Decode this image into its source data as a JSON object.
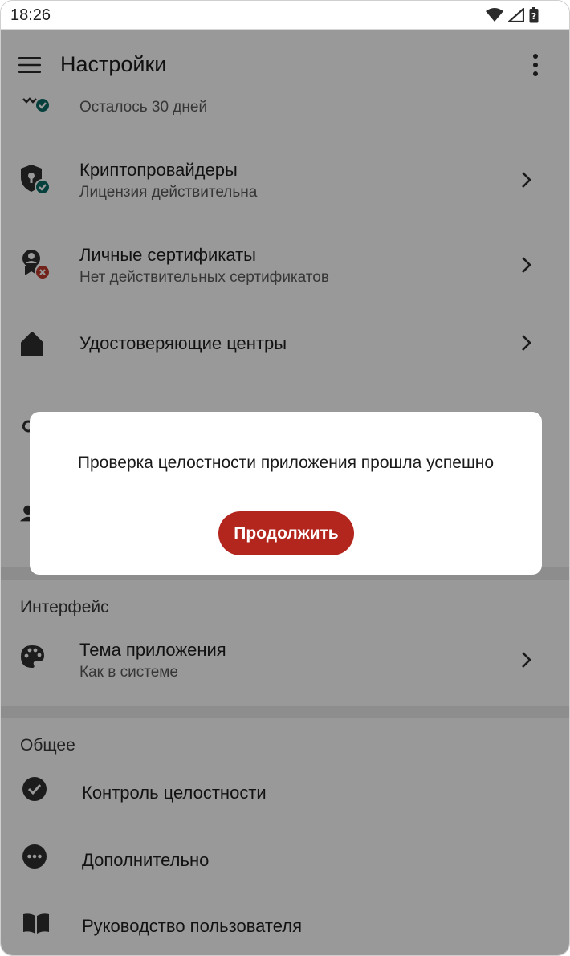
{
  "status_bar": {
    "time": "18:26"
  },
  "header": {
    "title": "Настройки"
  },
  "rows": {
    "trial": {
      "subtitle": "Осталось 30 дней"
    },
    "crypto": {
      "title": "Криптопровайдеры",
      "subtitle": "Лицензия действительна"
    },
    "personal_certs": {
      "title": "Личные сертификаты",
      "subtitle": "Нет действительных сертификатов"
    },
    "cas": {
      "title": "Удостоверяющие центры"
    },
    "theme": {
      "title": "Тема приложения",
      "subtitle": "Как в системе"
    },
    "integrity": {
      "title": "Контроль целостности"
    },
    "advanced": {
      "title": "Дополнительно"
    },
    "manual": {
      "title": "Руководство пользователя"
    }
  },
  "sections": {
    "interface": "Интерфейс",
    "general": "Общее"
  },
  "dialog": {
    "message": "Проверка целостности приложения прошла успешно",
    "button": "Продолжить"
  },
  "colors": {
    "accent": "#b3261e",
    "ok_badge": "#0b6b67",
    "error_badge": "#c0392b",
    "icon": "#2f2f2f"
  },
  "icons": {
    "status": [
      "wifi-icon",
      "cellular-signal-icon",
      "battery-unknown-icon"
    ],
    "menu": "hamburger-menu-icon",
    "more": "more-vert-icon",
    "trial": "trial-icon",
    "crypto": "shield-lock-icon",
    "personal_certs": "certificate-user-icon",
    "cas": "home-icon",
    "theme": "palette-icon",
    "integrity": "check-circle-icon",
    "advanced": "more-horiz-circle-icon",
    "manual": "book-open-icon",
    "chevron": "chevron-right-icon"
  }
}
